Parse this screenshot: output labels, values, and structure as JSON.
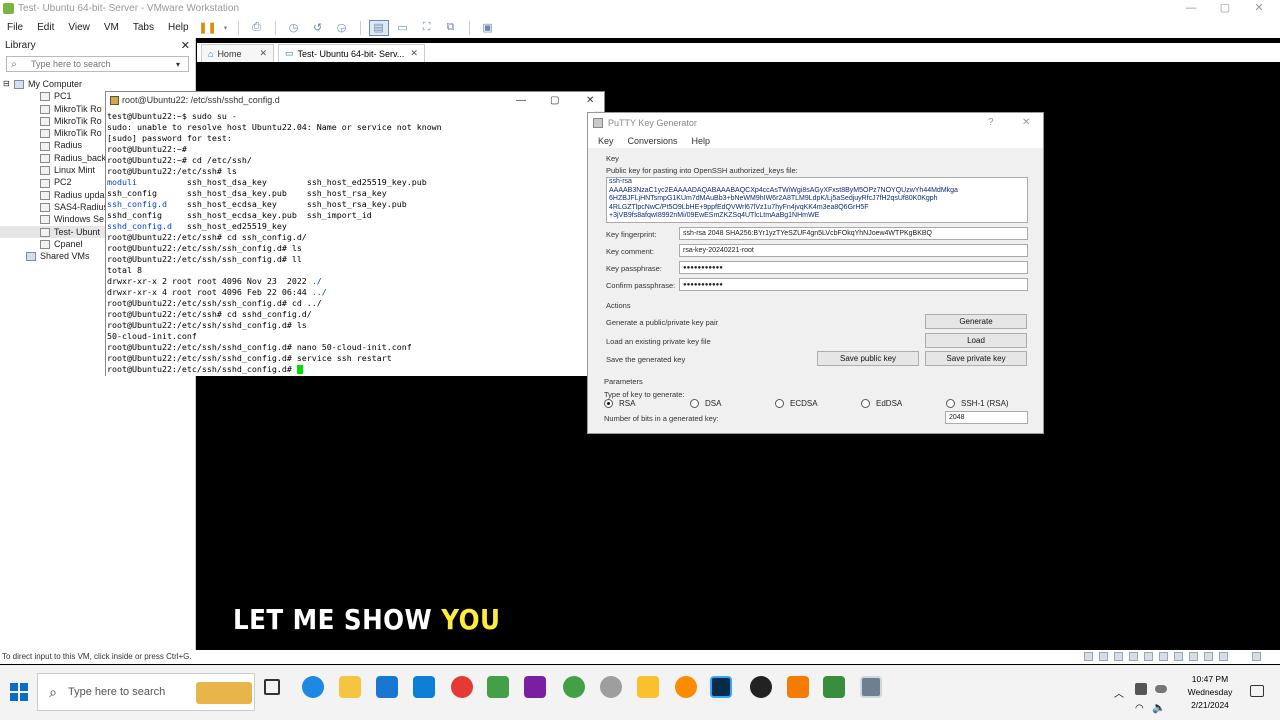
{
  "window_title": "Test- Ubuntu 64-bit- Server - VMware Workstation",
  "window_controls": {
    "minimize": "—",
    "maximize": "▢",
    "close": "✕"
  },
  "menu": [
    "File",
    "Edit",
    "View",
    "VM",
    "Tabs",
    "Help"
  ],
  "library": {
    "title": "Library",
    "close": "✕",
    "search_placeholder": "Type here to search",
    "root": "My Computer",
    "items": [
      "PC1",
      "MikroTik Ro",
      "MikroTik Ro",
      "MikroTik Ro",
      "Radius",
      "Radius_back",
      "Linux Mint",
      "PC2",
      "Radius upda",
      "SAS4-Radius",
      "Windows Se",
      "Test- Ubunt",
      "Cpanel"
    ],
    "shared": "Shared VMs",
    "selected_index": 11
  },
  "tabs": [
    {
      "label": "Home",
      "close": "✕"
    },
    {
      "label": "Test- Ubuntu 64-bit- Serv...",
      "close": "✕"
    }
  ],
  "terminal": {
    "title": "root@Ubuntu22: /etc/ssh/sshd_config.d"
  },
  "puttygen": {
    "title": "PuTTY Key Generator",
    "help_btn": "?",
    "close": "✕",
    "menu": [
      "Key",
      "Conversions",
      "Help"
    ],
    "key_section": "Key",
    "pub_label": "Public key for pasting into OpenSSH authorized_keys file:",
    "pub_key_lines": [
      "ssh-rsa",
      "AAAAB3NzaC1yc2EAAAADAQABAAABAQCXp4ccAsTWiWgi8sAGyXFxst8ByM5OPz7NOYQUzwYh44MdMkga",
      "6HZBJFLjHNTsmpG1KUm7dMAuBb3+bNeWM9hIW6r2A8TLM9LdpK/Lj5aSedjuyRfcJ7fH2qsUf80K0Kgph",
      "4RLGZTlpcNwC/Pt5O9LbHE+9ppfEdQVWrl67lVz1u7hyFn4jvqKK4m3ea8Q6GrH5F",
      "+3jVB9fs8afqwI8992nMi/09EwESmZKZSq4UTlcLtmAaBg1NHmWE"
    ],
    "fingerprint_label": "Key fingerprint:",
    "fingerprint": "ssh-rsa 2048 SHA256:BYr1yzTYeSZUF4gn5LVcbFOkqYhNJoew4WTPKgBKBQ",
    "comment_label": "Key comment:",
    "comment": "rsa-key-20240221-root",
    "passphrase_label": "Key passphrase:",
    "passphrase": "●●●●●●●●●●●",
    "confirm_label": "Confirm passphrase:",
    "confirm": "●●●●●●●●●●●",
    "actions_label": "Actions",
    "gen_label": "Generate a public/private key pair",
    "gen_btn": "Generate",
    "load_label": "Load an existing private key file",
    "load_btn": "Load",
    "save_label": "Save the generated key",
    "save_pub_btn": "Save public key",
    "save_priv_btn": "Save private key",
    "params_label": "Parameters",
    "type_label": "Type of key to generate:",
    "types": [
      "RSA",
      "DSA",
      "ECDSA",
      "EdDSA",
      "SSH-1 (RSA)"
    ],
    "selected_type": "RSA",
    "bits_label": "Number of bits in a generated key:",
    "bits": "2048"
  },
  "caption": {
    "text": "LET ME SHOW ",
    "accent": "YOU"
  },
  "status_text": "To direct input to this VM, click inside or press Ctrl+G.",
  "taskbar": {
    "search_placeholder": "Type here to search",
    "time": "10:47 PM",
    "day": "Wednesday",
    "date": "2/21/2024"
  }
}
